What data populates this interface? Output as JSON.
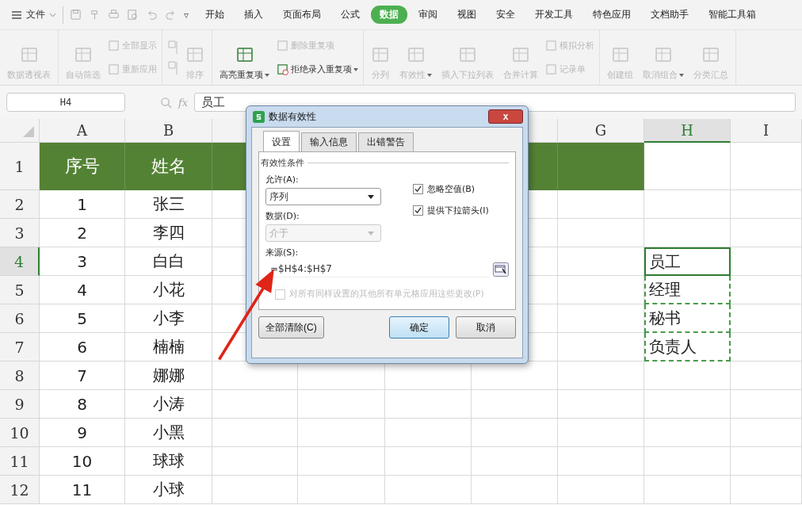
{
  "menu": {
    "file": "文件",
    "more": "▿",
    "tabs": [
      {
        "label": "开始",
        "selected": false
      },
      {
        "label": "插入",
        "selected": false
      },
      {
        "label": "页面布局",
        "selected": false
      },
      {
        "label": "公式",
        "selected": false
      },
      {
        "label": "数据",
        "selected": true
      },
      {
        "label": "审阅",
        "selected": false
      },
      {
        "label": "视图",
        "selected": false
      },
      {
        "label": "安全",
        "selected": false
      },
      {
        "label": "开发工具",
        "selected": false
      },
      {
        "label": "特色应用",
        "selected": false
      },
      {
        "label": "文档助手",
        "selected": false
      },
      {
        "label": "智能工具箱",
        "selected": false
      }
    ]
  },
  "ribbon": {
    "groups": [
      {
        "buttons": [
          {
            "label": "数据透视表",
            "kind": "large",
            "disabled": true,
            "dropdown": false
          }
        ]
      },
      {
        "buttons": [
          {
            "label": "自动筛选",
            "kind": "large",
            "disabled": true,
            "dropdown": false
          },
          {
            "label": "全部显示",
            "kind": "small",
            "disabled": true,
            "dropdown": false
          },
          {
            "label": "重新应用",
            "kind": "small",
            "disabled": true,
            "dropdown": false
          }
        ]
      },
      {
        "buttons": [
          {
            "label": "排序",
            "kind": "large",
            "disabled": true,
            "dropdown": false
          }
        ]
      },
      {
        "buttons": [
          {
            "label": "高亮重复项",
            "kind": "large",
            "disabled": false,
            "dropdown": true
          },
          {
            "label": "删除重复项",
            "kind": "small",
            "disabled": true,
            "dropdown": false
          },
          {
            "label": "拒绝录入重复项",
            "kind": "small",
            "disabled": false,
            "dropdown": true
          }
        ]
      },
      {
        "buttons": [
          {
            "label": "分列",
            "kind": "large",
            "disabled": true,
            "dropdown": false
          },
          {
            "label": "有效性",
            "kind": "large",
            "disabled": true,
            "dropdown": true
          },
          {
            "label": "插入下拉列表",
            "kind": "large",
            "disabled": true,
            "dropdown": false
          },
          {
            "label": "合并计算",
            "kind": "large",
            "disabled": true,
            "dropdown": false
          },
          {
            "label": "模拟分析",
            "kind": "small",
            "disabled": true,
            "dropdown": false
          },
          {
            "label": "记录单",
            "kind": "small",
            "disabled": true,
            "dropdown": false
          }
        ]
      },
      {
        "buttons": [
          {
            "label": "创建组",
            "kind": "large",
            "disabled": true,
            "dropdown": false
          },
          {
            "label": "取消组合",
            "kind": "large",
            "disabled": true,
            "dropdown": true
          },
          {
            "label": "分类汇总",
            "kind": "large",
            "disabled": true,
            "dropdown": false
          }
        ]
      }
    ]
  },
  "formula_bar": {
    "name_box": "H4",
    "fx": "fx",
    "value": "员工"
  },
  "sheet": {
    "columns": [
      {
        "label": "A",
        "selected": false
      },
      {
        "label": "B",
        "selected": false
      },
      {
        "selected": false
      },
      {},
      {},
      {
        "selected": false
      },
      {
        "label": "G",
        "selected": false
      },
      {
        "label": "H",
        "selected": true
      },
      {
        "label": "I",
        "selected": false
      }
    ],
    "rows": [
      {
        "number": "1",
        "kind": "header",
        "selected": false,
        "cells": [
          {
            "text": "序号",
            "filled": true
          },
          {
            "text": "姓名",
            "filled": true
          },
          {
            "filled": true
          },
          null,
          null,
          {
            "filled": true
          },
          {
            "filled": true
          },
          null,
          null
        ]
      },
      {
        "number": "2",
        "kind": "body",
        "selected": false,
        "cells": [
          {
            "text": "1"
          },
          {
            "text": "张三"
          },
          null,
          null,
          null,
          null,
          null,
          null,
          null
        ]
      },
      {
        "number": "3",
        "kind": "body",
        "selected": false,
        "cells": [
          {
            "text": "2"
          },
          {
            "text": "李四"
          },
          null,
          null,
          null,
          null,
          null,
          null,
          null
        ]
      },
      {
        "number": "4",
        "kind": "body",
        "selected": true,
        "cells": [
          {
            "text": "3"
          },
          {
            "text": "白白"
          },
          null,
          null,
          null,
          null,
          null,
          {
            "text": "员工",
            "active": true,
            "copied": true
          },
          null
        ]
      },
      {
        "number": "5",
        "kind": "body",
        "selected": false,
        "cells": [
          {
            "text": "4"
          },
          {
            "text": "小花"
          },
          null,
          null,
          null,
          null,
          null,
          {
            "text": "经理",
            "active": false,
            "copied": true
          },
          null
        ]
      },
      {
        "number": "6",
        "kind": "body",
        "selected": false,
        "cells": [
          {
            "text": "5"
          },
          {
            "text": "小李"
          },
          null,
          null,
          null,
          null,
          null,
          {
            "text": "秘书",
            "active": false,
            "copied": true
          },
          null
        ]
      },
      {
        "number": "7",
        "kind": "body",
        "selected": false,
        "cells": [
          {
            "text": "6"
          },
          {
            "text": "楠楠"
          },
          null,
          null,
          null,
          null,
          null,
          {
            "text": "负责人",
            "active": false,
            "copied": true
          },
          null
        ]
      },
      {
        "number": "8",
        "kind": "body",
        "selected": false,
        "cells": [
          {
            "text": "7"
          },
          {
            "text": "娜娜"
          },
          null,
          null,
          null,
          null,
          null,
          null,
          null
        ]
      },
      {
        "number": "9",
        "kind": "body",
        "selected": false,
        "cells": [
          {
            "text": "8"
          },
          {
            "text": "小涛"
          },
          null,
          null,
          null,
          null,
          null,
          null,
          null
        ]
      },
      {
        "number": "10",
        "kind": "body",
        "selected": false,
        "cells": [
          {
            "text": "9"
          },
          {
            "text": "小黑"
          },
          null,
          null,
          null,
          null,
          null,
          null,
          null
        ]
      },
      {
        "number": "11",
        "kind": "body",
        "selected": false,
        "cells": [
          {
            "text": "10"
          },
          {
            "text": "球球"
          },
          null,
          null,
          null,
          null,
          null,
          null,
          null
        ]
      },
      {
        "number": "12",
        "kind": "body",
        "selected": false,
        "cells": [
          {
            "text": "11"
          },
          {
            "text": "小球"
          },
          null,
          null,
          null,
          null,
          null,
          null,
          null
        ]
      }
    ]
  },
  "dialog": {
    "title": "数据有效性",
    "close": "x",
    "tabs": [
      {
        "label": "设置",
        "selected": true
      },
      {
        "label": "输入信息",
        "selected": false
      },
      {
        "label": "出错警告",
        "selected": false
      }
    ],
    "section": "有效性条件",
    "allow": {
      "label": "允许(A):",
      "value": "序列",
      "disabled": false
    },
    "ignore_blank": {
      "label": "忽略空值(B)",
      "checked": true,
      "disabled": false
    },
    "data": {
      "label": "数据(D):",
      "value": "介于",
      "disabled": true
    },
    "in_cell_dropdown": {
      "label": "提供下拉箭头(I)",
      "checked": true,
      "disabled": false
    },
    "source": {
      "label": "来源(S):",
      "value": "=$H$4:$H$7"
    },
    "apply_all": {
      "label": "对所有同样设置的其他所有单元格应用这些更改(P)",
      "checked": false,
      "disabled": true
    },
    "buttons": [
      {
        "label": "全部清除(C)",
        "default": false
      },
      {
        "label": "确定",
        "default": true
      },
      {
        "label": "取消",
        "default": false
      }
    ]
  }
}
